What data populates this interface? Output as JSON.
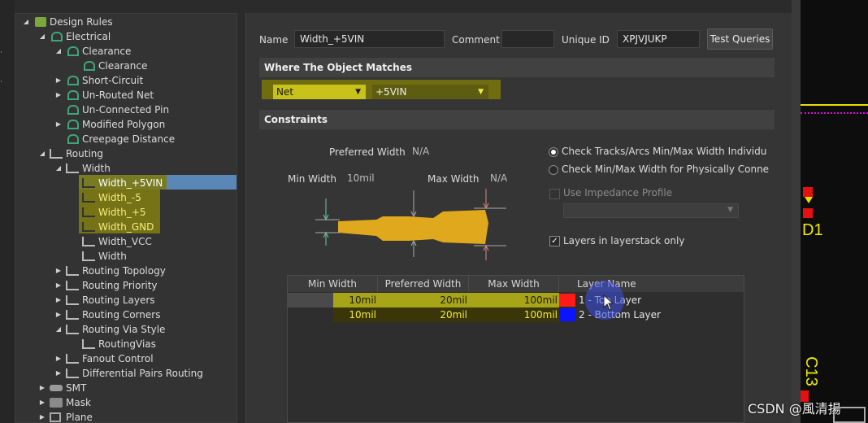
{
  "tree": {
    "root": "Design Rules",
    "electrical": "Electrical",
    "clearance": "Clearance",
    "clearance_child": "Clearance",
    "short_circuit": "Short-Circuit",
    "unrouted": "Un-Routed Net",
    "unconnected": "Un-Connected Pin",
    "modified_polygon": "Modified Polygon",
    "creepage": "Creepage Distance",
    "routing": "Routing",
    "width": "Width",
    "width_items": [
      "Width_+5VIN",
      "Width_-5",
      "Width_+5",
      "Width_GND",
      "Width_VCC",
      "Width"
    ],
    "routing_topology": "Routing Topology",
    "routing_priority": "Routing Priority",
    "routing_layers": "Routing Layers",
    "routing_corners": "Routing Corners",
    "routing_via_style": "Routing Via Style",
    "routing_vias": "RoutingVias",
    "fanout": "Fanout Control",
    "diff_pairs": "Differential Pairs Routing",
    "smt": "SMT",
    "mask": "Mask",
    "plane": "Plane"
  },
  "header": {
    "name_label": "Name",
    "name_value": "Width_+5VIN",
    "comment_label": "Comment",
    "comment_value": "",
    "uid_label": "Unique ID",
    "uid_value": "XPJVJUKP",
    "test_queries": "Test Queries"
  },
  "match": {
    "title": "Where The Object Matches",
    "type": "Net",
    "net": "+5VIN"
  },
  "constraints": {
    "title": "Constraints",
    "preferred_label": "Preferred Width",
    "preferred_value": "N/A",
    "min_label": "Min Width",
    "min_value": "10mil",
    "max_label": "Max Width",
    "max_value": "N/A",
    "radio1": "Check Tracks/Arcs Min/Max Width Individu",
    "radio2": "Check Min/Max Width for Physically Conne",
    "impedance": "Use Impedance Profile",
    "layers_only": "Layers in layerstack only"
  },
  "table": {
    "headers": [
      "Min Width",
      "Preferred Width",
      "Max Width",
      "Layer Name"
    ],
    "rows": [
      {
        "min": "10mil",
        "pref": "20mil",
        "max": "100mil",
        "layer": "1 - Top Layer",
        "color": "#ff1a1a"
      },
      {
        "min": "10mil",
        "pref": "20mil",
        "max": "100mil",
        "layer": "2 - Bottom Layer",
        "color": "#0a14ff"
      }
    ]
  },
  "pcb": {
    "d1": "D1",
    "c13": "C13"
  },
  "watermark": "CSDN @風清揚",
  "colors": {
    "highlight": "#c8c21a",
    "selection": "#5a87b6",
    "track": "#e0a81c",
    "pcb_yellow": "#e8e000"
  }
}
